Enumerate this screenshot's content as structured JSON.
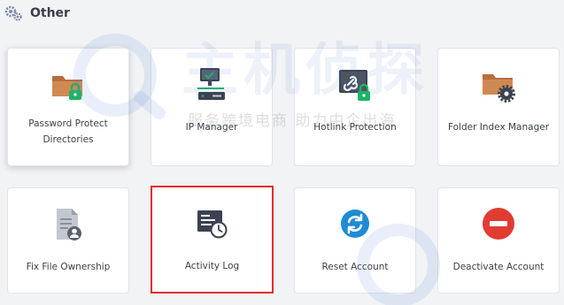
{
  "section": {
    "title": "Other",
    "icon": "gears-icon"
  },
  "cards": [
    {
      "id": "password-protect-directories",
      "label_line1": "Password Protect",
      "label_line2": "Directories",
      "icon": "folder-lock-icon"
    },
    {
      "id": "ip-manager",
      "label": "IP Manager",
      "icon": "ip-network-icon"
    },
    {
      "id": "hotlink-protection",
      "label": "Hotlink Protection",
      "icon": "hotlink-lock-icon"
    },
    {
      "id": "folder-index-manager",
      "label": "Folder Index Manager",
      "icon": "folder-gear-icon"
    },
    {
      "id": "fix-file-ownership",
      "label": "Fix File Ownership",
      "icon": "file-user-icon"
    },
    {
      "id": "activity-log",
      "label": "Activity Log",
      "icon": "activity-log-clock-icon"
    },
    {
      "id": "reset-account",
      "label": "Reset Account",
      "icon": "refresh-circle-icon"
    },
    {
      "id": "deactivate-account",
      "label": "Deactivate Account",
      "icon": "minus-circle-icon"
    }
  ],
  "watermark": {
    "brand": "主机侦探",
    "slogan": "服务跨境电商 助力中企出海"
  },
  "colors": {
    "folder": "#b86e3c",
    "lock": "#1fb366",
    "selection_border": "#e22d2d",
    "reset_blue": "#1f8bd6",
    "deactivate_red": "#e23b32"
  }
}
